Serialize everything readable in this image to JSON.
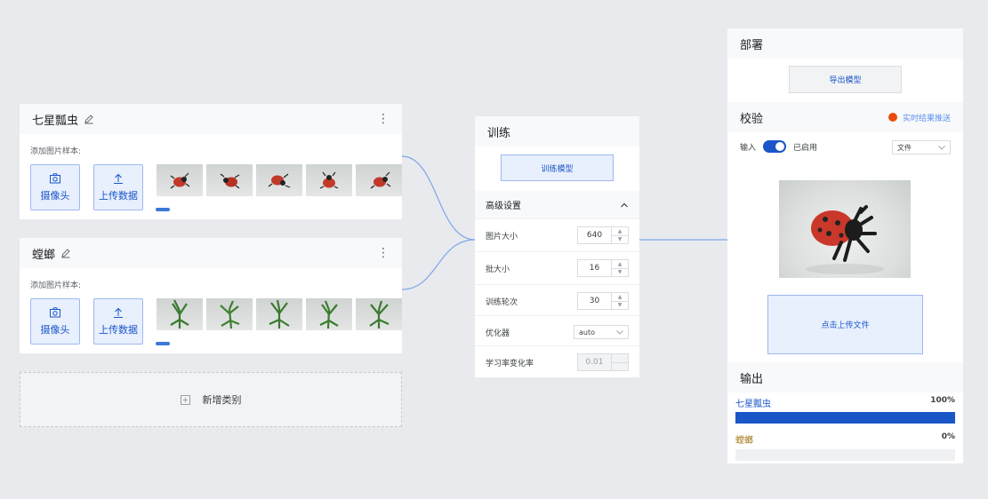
{
  "classes": [
    {
      "name": "七星瓢虫",
      "samples_label": "添加图片样本:",
      "webcam_label": "摄像头",
      "upload_label": "上传数据",
      "thumb_icon": "ladybug-image"
    },
    {
      "name": "螳螂",
      "samples_label": "添加图片样本:",
      "webcam_label": "摄像头",
      "upload_label": "上传数据",
      "thumb_icon": "mantis-image"
    }
  ],
  "add_class": {
    "label": "新增类别"
  },
  "training": {
    "title": "训练",
    "train_button": "训练模型",
    "advanced": {
      "title": "高级设置",
      "image_size": {
        "label": "图片大小",
        "value": "640"
      },
      "batch_size": {
        "label": "批大小",
        "value": "16"
      },
      "epochs": {
        "label": "训练轮次",
        "value": "30"
      },
      "optimizer": {
        "label": "优化器",
        "value": "auto"
      },
      "lr_decay": {
        "label": "学习率变化率",
        "value": "0.01"
      }
    }
  },
  "deploy": {
    "title": "部署",
    "export_button": "导出模型"
  },
  "validate": {
    "title": "校验",
    "live_label": "实时结果推送",
    "input_label": "输入",
    "enabled_label": "已启用",
    "source_value": "文件",
    "upload_label": "点击上传文件"
  },
  "output": {
    "title": "输出",
    "results": [
      {
        "name": "七星瓢虫",
        "percent_text": "100%",
        "value": 100,
        "color": "#1a56c8",
        "name_color": "#1a56c8"
      },
      {
        "name": "螳螂",
        "percent_text": "0%",
        "value": 0,
        "color": "#c08a1a",
        "name_color": "#a07412"
      }
    ]
  },
  "colors": {
    "accent": "#1a56c8",
    "accent_light": "#e8effd",
    "live_dot": "#ea4c0d"
  }
}
